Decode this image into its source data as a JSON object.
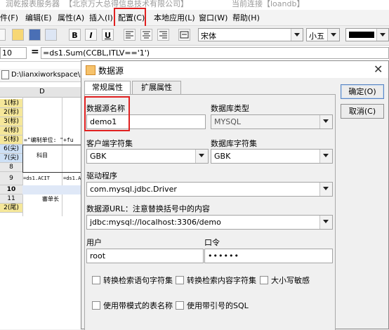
{
  "titlebar": {
    "app_title": "润乾报表服务器",
    "company": "【北京万大总得信息技术有限公司】",
    "connection": "当前连接【loandb】"
  },
  "menu": {
    "items": [
      {
        "label": "件(F)"
      },
      {
        "label": "编辑(E)"
      },
      {
        "label": "属性(A)"
      },
      {
        "label": "插入(I)"
      },
      {
        "label": "配置(C)"
      },
      {
        "label": "本地应用(L)"
      },
      {
        "label": "窗口(W)"
      },
      {
        "label": "帮助(H)"
      }
    ]
  },
  "toolbar": {
    "bold_label": "B",
    "italic_label": "I",
    "underline_label": "U",
    "font_name": "宋体",
    "font_size": "小五",
    "color": "#000000"
  },
  "formula": {
    "cell_ref": "10",
    "equals": "=",
    "expression": "=ds1.Sum(CCBL,ITLV=='1')"
  },
  "sheet": {
    "path": "D:\\lianxiworkspace\\p",
    "column_header": "D",
    "row_labels": [
      "1(标)",
      "2(标)",
      "3(标)",
      "4(标)",
      "5(标)",
      "6(尖)",
      "7(尖)",
      "8",
      "9",
      "10",
      "11",
      "2(尾)"
    ],
    "cells": {
      "r5": "=\"编制单位: \"+fu",
      "r6": "科目",
      "r9a": "=ds1.ACIT",
      "r9b": "=ds1.A",
      "r11": "審单长"
    }
  },
  "dialog": {
    "title": "数据源",
    "tabs": [
      "常规属性",
      "扩展属性"
    ],
    "buttons": {
      "ok": "确定(O)",
      "cancel": "取消(C)"
    },
    "fields": {
      "ds_name_label": "数据源名称",
      "ds_name_value": "demo1",
      "db_type_label": "数据库类型",
      "db_type_value": "MYSQL",
      "client_charset_label": "客户端字符集",
      "client_charset_value": "GBK",
      "db_charset_label": "数据库字符集",
      "db_charset_value": "GBK",
      "driver_label": "驱动程序",
      "driver_value": "com.mysql.jdbc.Driver",
      "url_label": "数据源URL：注意替换括号中的内容",
      "url_value": "jdbc:mysql://localhost:3306/demo",
      "user_label": "用户",
      "user_value": "root",
      "password_label": "口令",
      "password_value": "••••••"
    },
    "checkboxes": [
      {
        "label": "转换检索语句字符集",
        "checked": false
      },
      {
        "label": "转换检索内容字符集",
        "checked": false
      },
      {
        "label": "大小写敏感",
        "checked": false
      },
      {
        "label": "使用带模式的表名称",
        "checked": false
      },
      {
        "label": "使用带引号的SQL",
        "checked": false
      }
    ]
  },
  "highlight_color": "#e02020"
}
